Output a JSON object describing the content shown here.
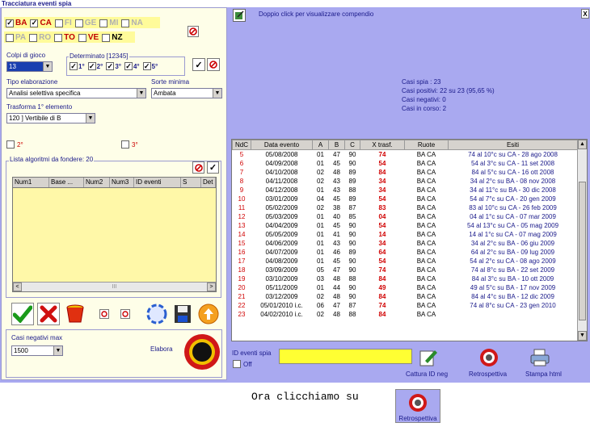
{
  "window": {
    "title": "Tracciatura eventi spia",
    "close_glyph": "X"
  },
  "header": {
    "hint": "Doppio click per visualizzare compendio"
  },
  "wheels_row1": [
    {
      "label": "BA",
      "checked": true,
      "state": "on"
    },
    {
      "label": "CA",
      "checked": true,
      "state": "on"
    },
    {
      "label": "FI",
      "checked": false,
      "state": "off"
    },
    {
      "label": "GE",
      "checked": false,
      "state": "off"
    },
    {
      "label": "MI",
      "checked": false,
      "state": "off"
    },
    {
      "label": "NA",
      "checked": false,
      "state": "off"
    }
  ],
  "wheels_row2": [
    {
      "label": "PA",
      "checked": false,
      "state": "off"
    },
    {
      "label": "RO",
      "checked": false,
      "state": "off"
    },
    {
      "label": "TO",
      "checked": false,
      "state": "on"
    },
    {
      "label": "VE",
      "checked": false,
      "state": "on"
    },
    {
      "label": "NZ",
      "checked": false,
      "state": "bl"
    }
  ],
  "colpi": {
    "label": "Colpi di gioco",
    "value": "13"
  },
  "determinato": {
    "label": "Determinato [12345]",
    "items": [
      {
        "label": "1°",
        "checked": true
      },
      {
        "label": "2°",
        "checked": true
      },
      {
        "label": "3°",
        "checked": true
      },
      {
        "label": "4°",
        "checked": true
      },
      {
        "label": "5°",
        "checked": true
      }
    ],
    "check_glyph": "✓"
  },
  "tipo": {
    "label": "Tipo elaborazione",
    "value": "Analisi selettiva specifica"
  },
  "sorte": {
    "label": "Sorte minima",
    "value": "Ambata"
  },
  "trasforma": {
    "label": "Trasforma 1° elemento",
    "value": "120 ] Vertibile di B"
  },
  "opt2": {
    "label": "2°"
  },
  "opt3": {
    "label": "3°"
  },
  "lista": {
    "label": "Lista algoritmi da fondere: 20",
    "columns": [
      "Num1",
      "Base ...",
      "Num2",
      "Num3",
      "ID eventi",
      "S",
      "Det"
    ],
    "scroll_left": "<",
    "scroll_right": ">",
    "scroll_mid": "III"
  },
  "casi_neg_max": {
    "label": "Casi negativi max",
    "value": "1500"
  },
  "elabora": {
    "label": "Elabora"
  },
  "summary": {
    "spia": "Casi spia : 23",
    "positivi": "Casi positivi: 22 su 23 (95,65 %)",
    "negativi": "Casi negativi: 0",
    "in_corso": "Casi in corso: 2"
  },
  "events_table": {
    "columns": [
      "NdC",
      "Data evento",
      "A",
      "B",
      "C",
      "X trasf.",
      "Ruote",
      "Esiti"
    ],
    "rows": [
      [
        "5",
        "05/08/2008",
        "01",
        "47",
        "90",
        "74",
        "BA CA",
        "74 al 10°c su CA - 28 ago 2008"
      ],
      [
        "6",
        "04/09/2008",
        "01",
        "45",
        "90",
        "54",
        "BA CA",
        "54 al 3°c su CA - 11 set 2008"
      ],
      [
        "7",
        "04/10/2008",
        "02",
        "48",
        "89",
        "84",
        "BA CA",
        "84 al 5°c su CA - 16 ott 2008"
      ],
      [
        "8",
        "04/11/2008",
        "02",
        "43",
        "89",
        "34",
        "BA CA",
        "34 al 2°c su BA - 08 nov 2008"
      ],
      [
        "9",
        "04/12/2008",
        "01",
        "43",
        "88",
        "34",
        "BA CA",
        "34 al 11°c su BA - 30 dic 2008"
      ],
      [
        "10",
        "03/01/2009",
        "04",
        "45",
        "89",
        "54",
        "BA CA",
        "54 al 7°c su CA - 20 gen 2009"
      ],
      [
        "11",
        "05/02/2009",
        "02",
        "38",
        "87",
        "83",
        "BA CA",
        "83 al 10°c su CA - 26 feb 2009"
      ],
      [
        "12",
        "05/03/2009",
        "01",
        "40",
        "85",
        "04",
        "BA CA",
        "04 al 1°c su CA - 07 mar 2009"
      ],
      [
        "13",
        "04/04/2009",
        "01",
        "45",
        "90",
        "54",
        "BA CA",
        "54 al 13°c su CA - 05 mag 2009"
      ],
      [
        "14",
        "05/05/2009",
        "01",
        "41",
        "90",
        "14",
        "BA CA",
        "14 al 1°c su CA - 07 mag 2009"
      ],
      [
        "15",
        "04/06/2009",
        "01",
        "43",
        "90",
        "34",
        "BA CA",
        "34 al 2°c su BA - 06 giu 2009"
      ],
      [
        "16",
        "04/07/2009",
        "01",
        "46",
        "89",
        "64",
        "BA CA",
        "64 al 2°c su BA - 09 lug 2009"
      ],
      [
        "17",
        "04/08/2009",
        "01",
        "45",
        "90",
        "54",
        "BA CA",
        "54 al 2°c su CA - 08 ago 2009"
      ],
      [
        "18",
        "03/09/2009",
        "05",
        "47",
        "90",
        "74",
        "BA CA",
        "74 al 8°c su BA - 22 set 2009"
      ],
      [
        "19",
        "03/10/2009",
        "03",
        "48",
        "88",
        "84",
        "BA CA",
        "84 al 3°c su BA - 10 ott 2009"
      ],
      [
        "20",
        "05/11/2009",
        "01",
        "44",
        "90",
        "49",
        "BA CA",
        "49 al 5°c su BA - 17 nov 2009"
      ],
      [
        "21",
        "03/12/2009",
        "02",
        "48",
        "90",
        "84",
        "BA CA",
        "84 al 4°c su BA - 12 dic 2009"
      ],
      [
        "22",
        "05/01/2010 i.c.",
        "06",
        "47",
        "87",
        "74",
        "BA CA",
        "74 al 8°c su CA - 23 gen 2010"
      ],
      [
        "23",
        "04/02/2010 i.c.",
        "02",
        "48",
        "88",
        "84",
        "BA CA",
        ""
      ]
    ]
  },
  "id_eventi": {
    "label": "ID eventi spia",
    "value": "",
    "off_label": "Off"
  },
  "bottom_buttons": {
    "cattura": "Cattura ID neg",
    "retrospettiva": "Retrospettiva",
    "stampa": "Stampa html"
  },
  "footer": {
    "instruction": "Ora clicchiamo su",
    "button_caption": "Retrospettiva"
  }
}
